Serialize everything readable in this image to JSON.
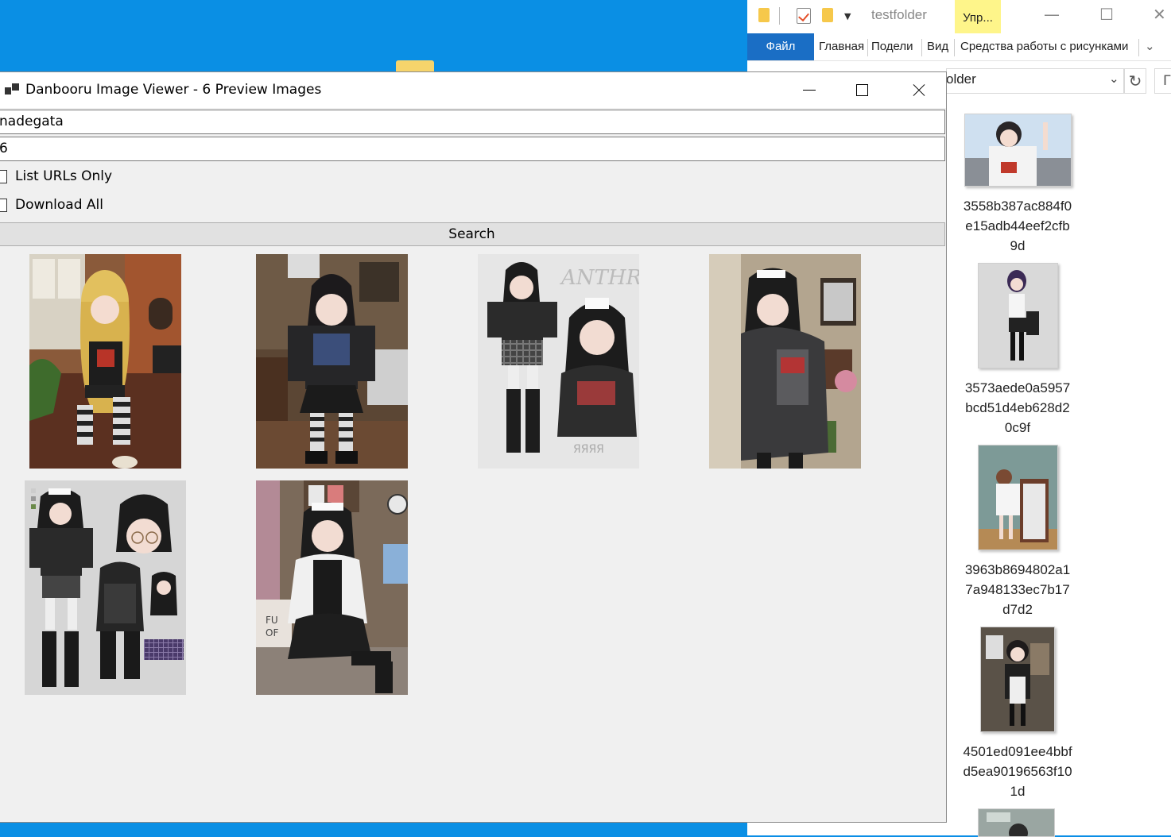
{
  "app": {
    "title": "Danbooru Image Viewer - 6 Preview Images",
    "tags_value": "nadegata",
    "count_value": "6",
    "list_urls_label": "List URLs Only",
    "download_all_label": "Download All",
    "search_label": "Search",
    "previews": [
      {
        "subject": "blonde girl sitting with striped stockings"
      },
      {
        "subject": "dark-haired girl in black hoodie posing in room"
      },
      {
        "subject": "character sheet with ANTHRAX text"
      },
      {
        "subject": "maid girl in gray hoodie"
      },
      {
        "subject": "character reference sheet maid"
      },
      {
        "subject": "maid girl sitting on bed"
      }
    ]
  },
  "explorer": {
    "window_title": "testfolder",
    "manage_tab": "Упр...",
    "ribbon_tabs": [
      "Файл",
      "Главная",
      "Подели",
      "Вид",
      "Средства работы с рисунками"
    ],
    "address_text": "older",
    "files": [
      {
        "name": "3558b387ac884f0e15adb44eef2cfb9d"
      },
      {
        "name": "3573aede0a5957bcd51d4eb628d20c9f"
      },
      {
        "name": "3963b8694802a17a948133ec7b17d7d2"
      },
      {
        "name": "4501ed091ee4bbfd5ea90196563f101d"
      }
    ]
  },
  "colors": {
    "desktop": "#0a8fe4",
    "ribbon_file": "#1a6ec5",
    "manage_highlight": "#fef58a"
  }
}
